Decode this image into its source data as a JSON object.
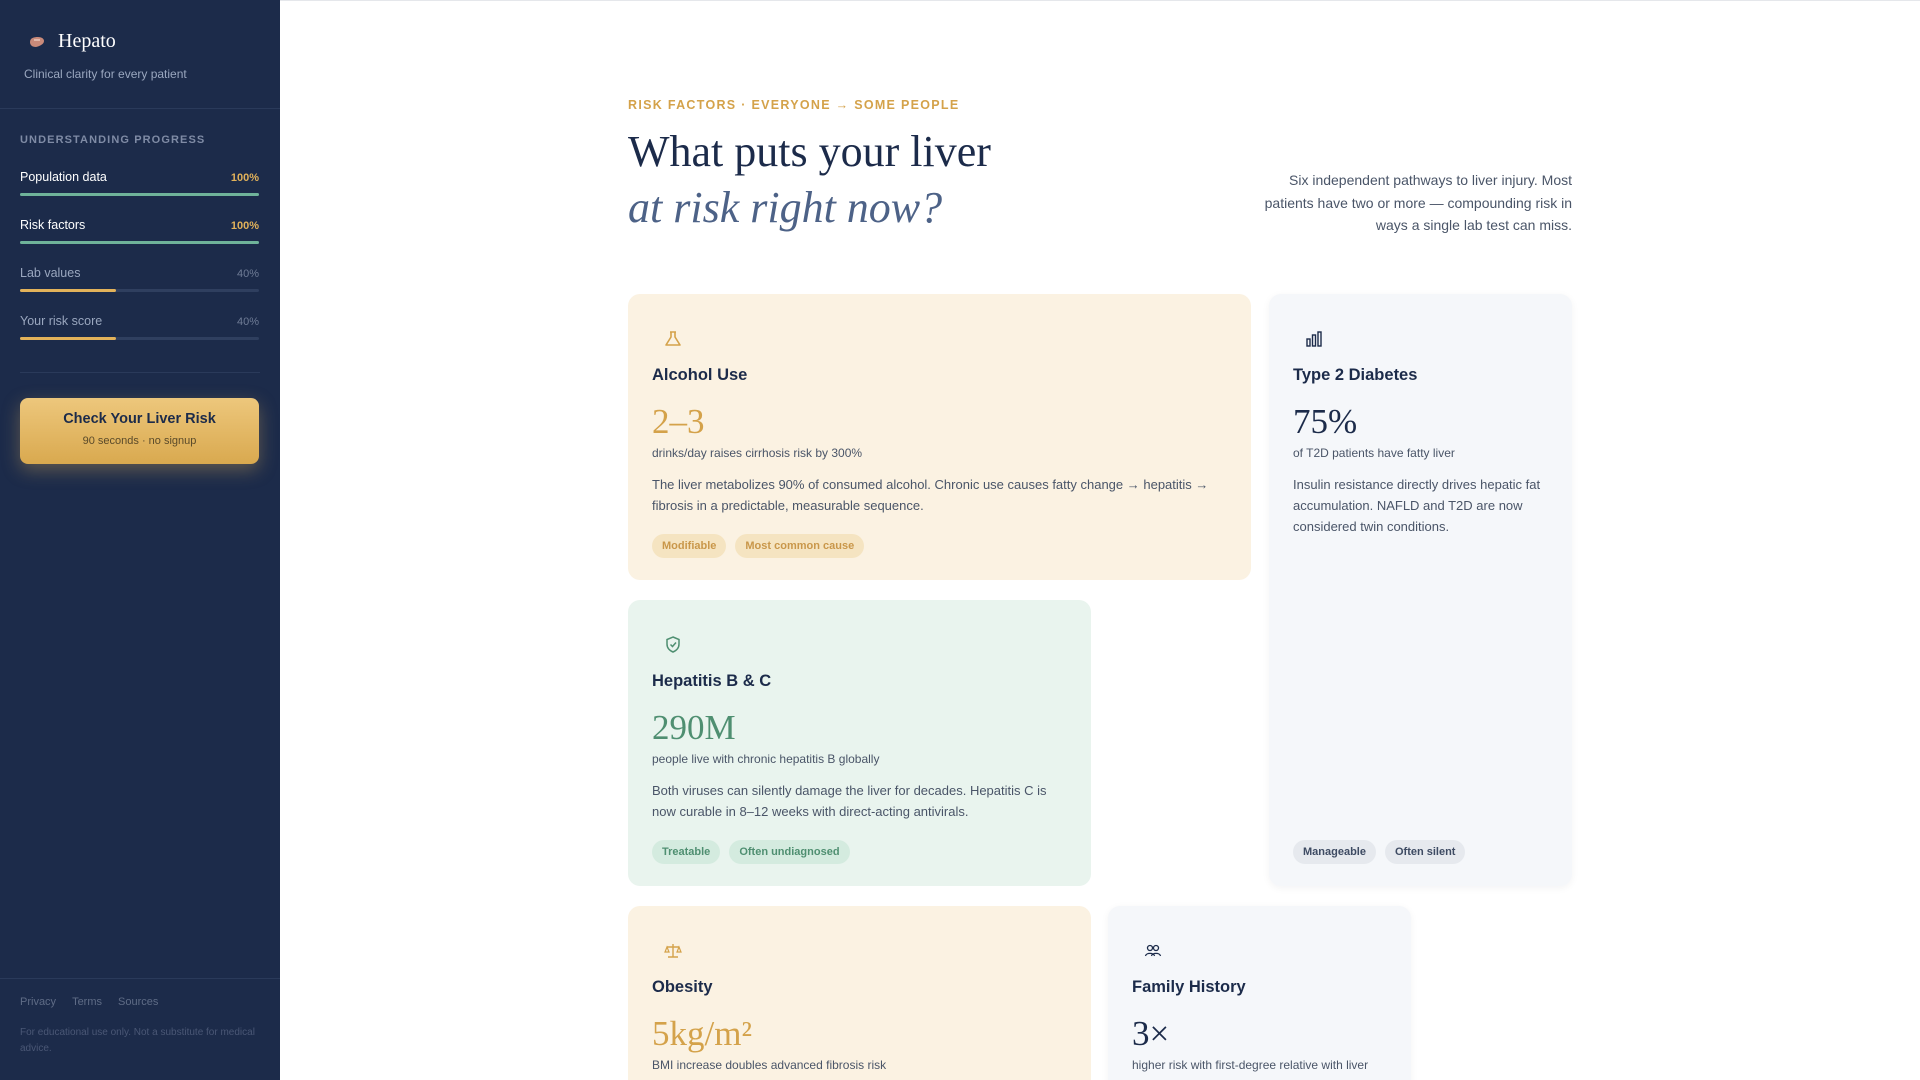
{
  "sidebar": {
    "brand": "Hepato",
    "tagline": "Clinical clarity for every patient",
    "progress_heading": "UNDERSTANDING PROGRESS",
    "progress": [
      {
        "label": "Population data",
        "percent_text": "100%",
        "value": 1.0
      },
      {
        "label": "Risk factors",
        "percent_text": "100%",
        "value": 1.0
      },
      {
        "label": "Lab values",
        "percent_text": "40%",
        "value": 0.4
      },
      {
        "label": "Your risk score",
        "percent_text": "40%",
        "value": 0.4
      }
    ],
    "cta": {
      "title": "Check Your Liver Risk",
      "subtitle": "90 seconds · no signup"
    },
    "footer_links": [
      "Privacy",
      "Terms",
      "Sources"
    ],
    "disclaimer": "For educational use only. Not a substitute for medical advice."
  },
  "main": {
    "eyebrow": "RISK FACTORS · EVERYONE → SOME PEOPLE",
    "title_line1": "What puts your liver",
    "title_line2": "at risk right now?",
    "intro": "Six independent pathways to liver injury. Most patients have two or more — compounding risk in ways a single lab test can miss."
  },
  "cards": [
    {
      "icon": "flask-icon",
      "title": "Alcohol Use",
      "stat": "2–3",
      "stat_note": "drinks/day raises cirrhosis risk by 300%",
      "body": "The liver metabolizes 90% of consumed alcohol. Chronic use causes fatty change → hepatitis → fibrosis in a predictable, measurable sequence.",
      "tags": [
        "Modifiable",
        "Most common cause"
      ]
    },
    {
      "icon": "bar-chart-icon",
      "title": "Type 2 Diabetes",
      "stat": "75%",
      "stat_note": "of T2D patients have fatty liver",
      "body": "Insulin resistance directly drives hepatic fat accumulation. NAFLD and T2D are now considered twin conditions.",
      "tags": [
        "Manageable",
        "Often silent"
      ]
    },
    {
      "icon": "shield-check-icon",
      "title": "Hepatitis B & C",
      "stat": "290M",
      "stat_note": "people live with chronic hepatitis B globally",
      "body": "Both viruses can silently damage the liver for decades. Hepatitis C is now curable in 8–12 weeks with direct-acting antivirals.",
      "tags": [
        "Treatable",
        "Often undiagnosed"
      ]
    },
    {
      "icon": "scale-icon",
      "title": "Obesity",
      "stat": "5kg/m²",
      "stat_note": "BMI increase doubles advanced fibrosis risk",
      "body": "",
      "tags": []
    },
    {
      "icon": "people-icon",
      "title": "Family History",
      "stat": "3×",
      "stat_note": "higher risk with first-degree relative with liver",
      "body": "",
      "tags": []
    }
  ],
  "colors": {
    "sidebar": "#1c2b4a",
    "accent": "#d4a24a",
    "green": "#4f8f71"
  }
}
